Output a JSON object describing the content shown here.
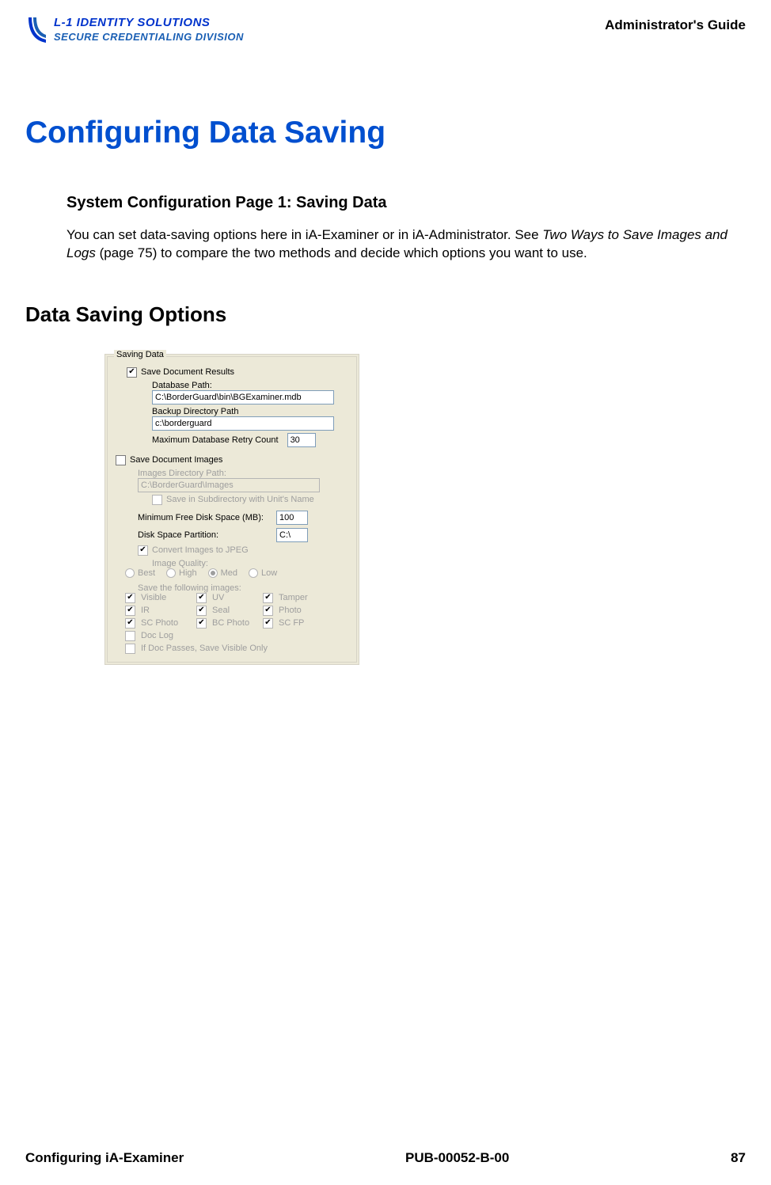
{
  "header": {
    "logo_line1": "L-1 IDENTITY SOLUTIONS",
    "logo_line2": "SECURE CREDENTIALING DIVISION",
    "guide_title": "Administrator's Guide"
  },
  "page_title": "Configuring Data Saving",
  "subhead": "System Configuration Page 1: Saving Data",
  "body": {
    "part1": "You can set data-saving options here in iA-Examiner or in iA-Administrator. See ",
    "italic": "Two Ways to Save Images and Logs",
    "part2": " (page 75) to compare the two methods and decide which options you want to use."
  },
  "section_head": "Data Saving Options",
  "dialog": {
    "group_title": "Saving Data",
    "save_doc_results": "Save Document Results",
    "db_path_label": "Database Path:",
    "db_path_value": "C:\\BorderGuard\\bin\\BGExaminer.mdb",
    "backup_dir_label": "Backup Directory Path",
    "backup_dir_value": "c:\\borderguard",
    "max_retry_label": "Maximum Database Retry Count",
    "max_retry_value": "30",
    "save_doc_images": "Save Document Images",
    "images_dir_label": "Images Directory Path:",
    "images_dir_value": "C:\\BorderGuard\\Images",
    "save_subdir": "Save in Subdirectory with Unit's Name",
    "min_free_label": "Minimum Free Disk Space (MB):",
    "min_free_value": "100",
    "disk_part_label": "Disk Space Partition:",
    "disk_part_value": "C:\\",
    "convert_jpeg": "Convert Images to JPEG",
    "image_quality_label": "Image Quality:",
    "q_best": "Best",
    "q_high": "High",
    "q_med": "Med",
    "q_low": "Low",
    "save_following": "Save the following images:",
    "img_visible": "Visible",
    "img_uv": "UV",
    "img_tamper": "Tamper",
    "img_ir": "IR",
    "img_seal": "Seal",
    "img_photo": "Photo",
    "img_scphoto": "SC Photo",
    "img_bcphoto": "BC Photo",
    "img_scfp": "SC FP",
    "img_doclog": "Doc Log",
    "img_ifpass": "If Doc Passes, Save Visible Only"
  },
  "footer": {
    "left": "Configuring iA-Examiner",
    "center": "PUB-00052-B-00",
    "right": "87"
  }
}
